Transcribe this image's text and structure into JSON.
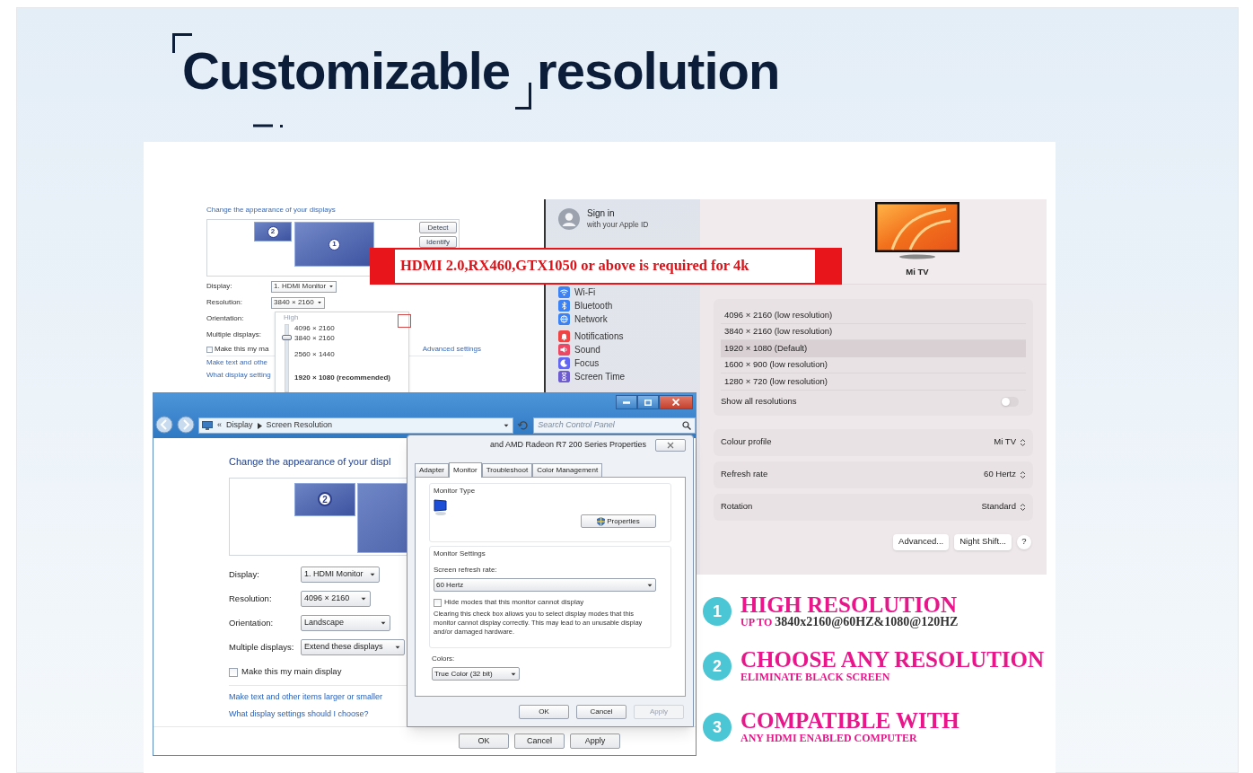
{
  "heading": {
    "words": [
      "Customizable",
      "resolution"
    ]
  },
  "small_window": {
    "title": "Change the appearance of your displays",
    "monitors": [
      "2",
      "1"
    ],
    "buttons": [
      "Detect",
      "Identify"
    ],
    "fields": [
      {
        "label": "Display:",
        "value": "1. HDMI Monitor"
      },
      {
        "label": "Resolution:",
        "value": "3840 × 2160"
      },
      {
        "label": "Orientation:"
      },
      {
        "label": "Multiple displays:"
      }
    ],
    "checkbox": {
      "label": "Make this my ma",
      "checked": false
    },
    "advanced_link": "Advanced settings",
    "links": [
      "Make text and othe",
      "What display setting"
    ],
    "dropdown": {
      "heading": "High",
      "options": [
        "4096 × 2160",
        "3840 × 2160",
        "2560 × 1440",
        "1920 × 1080 (recommended)"
      ],
      "level": 0.85
    }
  },
  "banner": "HDMI 2.0,RX460,GTX1050 or above is required for 4k",
  "mac": {
    "account": {
      "title": "Sign in",
      "subtitle": "with your Apple ID"
    },
    "sidebar": [
      {
        "label": "Wi-Fi",
        "kind": "wifi",
        "color": "#3b82f6"
      },
      {
        "label": "Bluetooth",
        "kind": "bluetooth",
        "color": "#3b82f6"
      },
      {
        "label": "Network",
        "kind": "network",
        "color": "#3b82f6"
      },
      {
        "label": "Notifications",
        "kind": "bell",
        "color": "#ef4444"
      },
      {
        "label": "Sound",
        "kind": "speaker",
        "color": "#ec4863"
      },
      {
        "label": "Focus",
        "kind": "moon",
        "color": "#6366f1"
      },
      {
        "label": "Screen Time",
        "kind": "hourglass",
        "color": "#6d5bd0"
      }
    ],
    "display_name": "Mi TV",
    "resolutions": [
      {
        "label": "4096 × 2160 (low resolution)",
        "selected": false
      },
      {
        "label": "3840 × 2160 (low resolution)",
        "selected": false
      },
      {
        "label": "1920 × 1080 (Default)",
        "selected": true
      },
      {
        "label": "1600 × 900 (low resolution)",
        "selected": false
      },
      {
        "label": "1280 × 720 (low resolution)",
        "selected": false
      }
    ],
    "show_all": {
      "label": "Show all resolutions",
      "on": false
    },
    "settings": [
      {
        "label": "Colour profile",
        "value": "Mi TV"
      },
      {
        "label": "Refresh rate",
        "value": "60 Hertz"
      },
      {
        "label": "Rotation",
        "value": "Standard"
      }
    ],
    "buttons": [
      "Advanced...",
      "Night Shift...",
      "?"
    ]
  },
  "window": {
    "breadcrumb": [
      "«",
      "Display",
      "Screen Resolution"
    ],
    "search_placeholder": "Search Control Panel",
    "heading": "Change the appearance of your displ",
    "monitor": "2",
    "fields": [
      {
        "label": "Display:",
        "value": "1. HDMI Monitor"
      },
      {
        "label": "Resolution:",
        "value": "4096 × 2160"
      },
      {
        "label": "Orientation:",
        "value": "Landscape"
      },
      {
        "label": "Multiple displays:",
        "value": "Extend these displays"
      }
    ],
    "checkbox": {
      "label": "Make this my main display",
      "checked": false
    },
    "links": [
      "Make text and other items larger or smaller",
      "What display settings should I choose?"
    ],
    "buttons": [
      "OK",
      "Cancel",
      "Apply"
    ]
  },
  "dialog": {
    "title": "and AMD Radeon R7 200 Series Properties",
    "tabs": [
      {
        "label": "Adapter",
        "selected": false
      },
      {
        "label": "Monitor",
        "selected": true
      },
      {
        "label": "Troubleshoot",
        "selected": false
      },
      {
        "label": "Color Management",
        "selected": false
      }
    ],
    "monitor_type": {
      "legend": "Monitor Type",
      "button": "Properties"
    },
    "monitor_settings": {
      "legend": "Monitor Settings",
      "refresh_label": "Screen refresh rate:",
      "refresh_value": "60 Hertz",
      "checkbox": {
        "label": "Hide modes that this monitor cannot display",
        "checked": false
      },
      "note": "Clearing this check box allows you to select display modes that this monitor cannot display correctly. This may lead to an unusable display and/or damaged hardware."
    },
    "colors": {
      "label": "Colors:",
      "value": "True Color (32 bit)"
    },
    "buttons": [
      {
        "label": "OK",
        "disabled": false
      },
      {
        "label": "Cancel",
        "disabled": false
      },
      {
        "label": "Apply",
        "disabled": true
      }
    ]
  },
  "features": [
    {
      "number": "1",
      "title": "HIGH RESOLUTION",
      "subtitle": [
        {
          "text": "UP TO",
          "kind": "accent"
        },
        {
          "text": "3840x2160@60HZ&1080@120HZ",
          "kind": "plain"
        }
      ]
    },
    {
      "number": "2",
      "title": "CHOOSE ANY RESOLUTION",
      "subtitle": [
        {
          "text": "ELIMINATE BLACK SCREEN",
          "kind": "accent"
        }
      ]
    },
    {
      "number": "3",
      "title": "COMPATIBLE WITH",
      "subtitle": [
        {
          "text": "ANY HDMI ENABLED COMPUTER",
          "kind": "accent"
        }
      ]
    }
  ]
}
